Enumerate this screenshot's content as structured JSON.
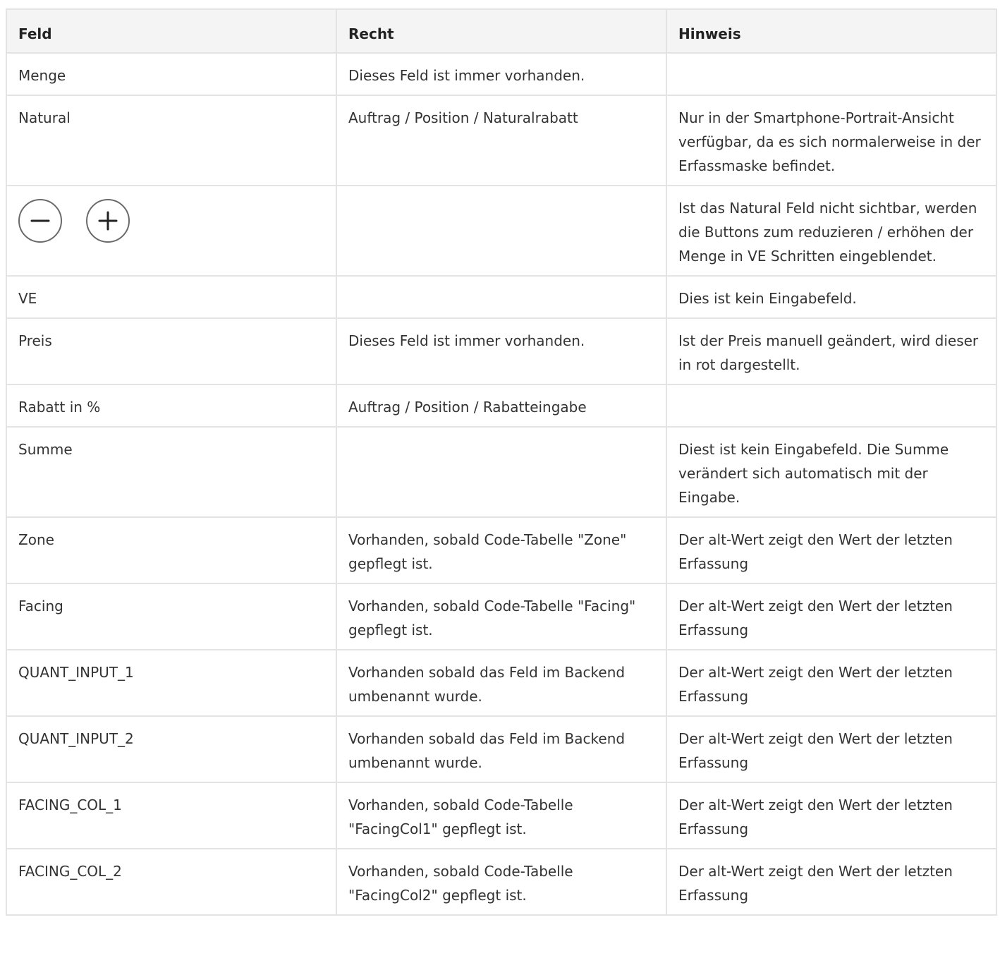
{
  "table": {
    "headers": {
      "feld": "Feld",
      "recht": "Recht",
      "hinweis": "Hinweis"
    },
    "rows": [
      {
        "feld": "Menge",
        "recht": "Dieses Feld ist immer vorhanden.",
        "hinweis": ""
      },
      {
        "feld": "Natural",
        "recht": "Auftrag / Position / Naturalrabatt",
        "hinweis": "Nur in der Smartphone-Portrait-Ansicht verfügbar, da es sich normalerweise in der Erfassmaske befindet."
      },
      {
        "feld": "",
        "recht": "",
        "hinweis": "Ist das Natural Feld nicht sichtbar, werden die Buttons zum reduzieren / erhöhen der Menge in VE Schritten eingeblendet.",
        "icons": [
          "minus-circle-icon",
          "plus-circle-icon"
        ]
      },
      {
        "feld": "VE",
        "recht": "",
        "hinweis": "Dies ist kein Eingabefeld."
      },
      {
        "feld": "Preis",
        "recht": "Dieses Feld ist immer vorhanden.",
        "hinweis": "Ist der Preis manuell geändert, wird dieser in rot dargestellt."
      },
      {
        "feld": "Rabatt in %",
        "recht": "Auftrag / Position / Rabatteingabe",
        "hinweis": ""
      },
      {
        "feld": "Summe",
        "recht": "",
        "hinweis": "Diest ist kein Eingabefeld. Die Summe verändert sich automatisch mit der Eingabe."
      },
      {
        "feld": "Zone",
        "recht": "Vorhanden, sobald Code-Tabelle \"Zone\" gepflegt ist.",
        "hinweis": "Der alt-Wert zeigt den Wert der letzten Erfassung"
      },
      {
        "feld": "Facing",
        "recht": "Vorhanden, sobald Code-Tabelle \"Facing\" gepflegt ist.",
        "hinweis": "Der alt-Wert zeigt den Wert der letzten Erfassung"
      },
      {
        "feld": "QUANT_INPUT_1",
        "recht": "Vorhanden sobald das Feld im Backend umbenannt wurde.",
        "hinweis": "Der alt-Wert zeigt den Wert der letzten Erfassung"
      },
      {
        "feld": "QUANT_INPUT_2",
        "recht": "Vorhanden sobald das Feld im Backend umbenannt wurde.",
        "hinweis": "Der alt-Wert zeigt den Wert der letzten Erfassung"
      },
      {
        "feld": "FACING_COL_1",
        "recht": "Vorhanden, sobald Code-Tabelle \"FacingCol1\" gepflegt ist.",
        "hinweis": "Der alt-Wert zeigt den Wert der letzten Erfassung"
      },
      {
        "feld": "FACING_COL_2",
        "recht": "Vorhanden, sobald Code-Tabelle \"FacingCol2\" gepflegt ist.",
        "hinweis": "Der alt-Wert zeigt den Wert der letzten Erfassung"
      }
    ]
  }
}
